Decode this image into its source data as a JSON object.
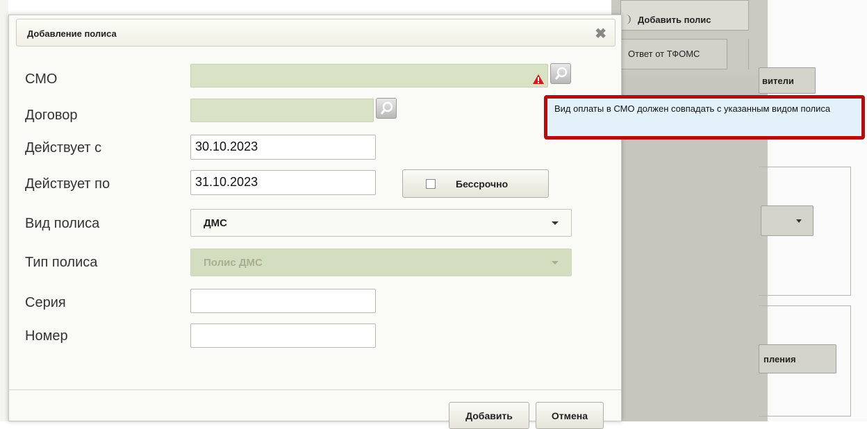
{
  "background": {
    "add_policy_tab": "Добавить полис",
    "tfoms_tab": "Ответ от ТФОМС",
    "partial_button_1": "вители",
    "partial_button_2": "пления"
  },
  "tooltip": {
    "text": "Вид оплаты в СМО должен совпадать с указанным видом полиса",
    "border_color": "#b30d0d"
  },
  "dialog": {
    "title": "Добавление полиса",
    "fields": {
      "smo": {
        "label": "СМО",
        "value": ""
      },
      "contract": {
        "label": "Договор",
        "value": ""
      },
      "valid_from": {
        "label": "Действует с",
        "value": "30.10.2023"
      },
      "valid_to": {
        "label": "Действует по",
        "value": "31.10.2023"
      },
      "policy_kind": {
        "label": "Вид полиса",
        "value": "ДМС"
      },
      "policy_type": {
        "label": "Тип полиса",
        "value": "Полис ДМС"
      },
      "series": {
        "label": "Серия",
        "value": ""
      },
      "number": {
        "label": "Номер",
        "value": ""
      }
    },
    "indefinite_button": "Бессрочно",
    "add_button": "Добавить",
    "cancel_button": "Отмена"
  },
  "colors": {
    "required_field_bg": "#d8e3c6",
    "warning_icon": "#d11a1a"
  },
  "icons": [
    "close-icon",
    "search-icon",
    "warning-icon",
    "chevron-down-icon"
  ]
}
